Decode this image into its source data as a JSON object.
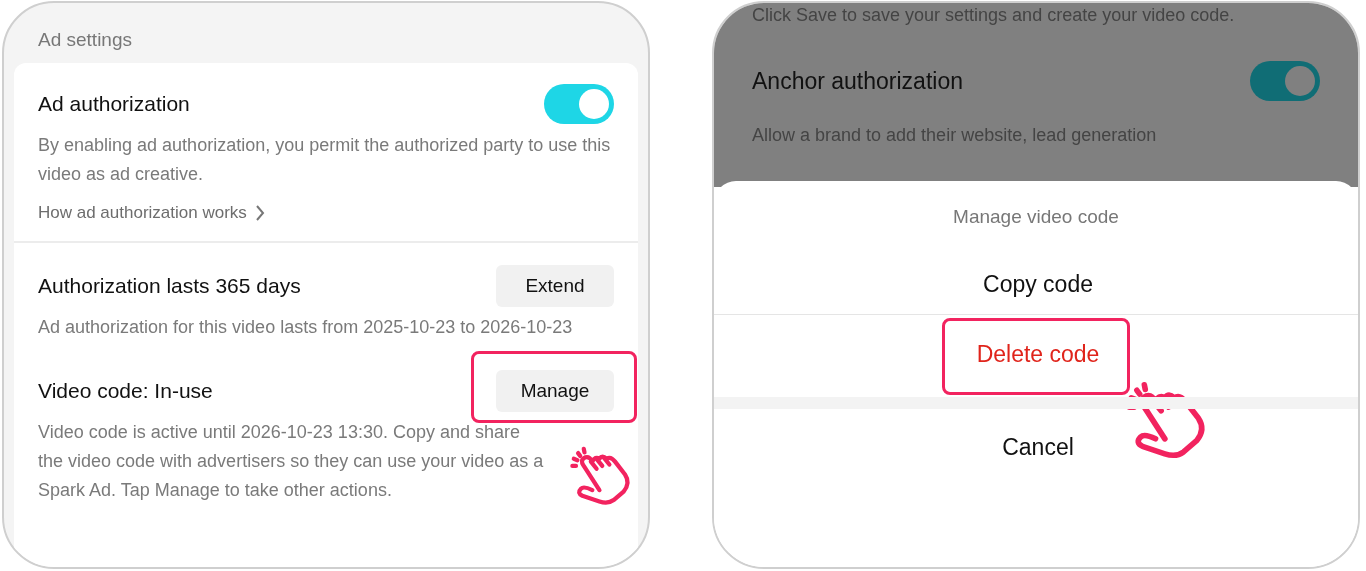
{
  "left_screen": {
    "section_title": "Ad settings",
    "settings": [
      {
        "kind": "toggle",
        "title": "Ad authorization",
        "on": true,
        "description": "By enabling ad authorization, you permit the authorized party to use this video as ad creative.",
        "link": "How ad authorization works"
      },
      {
        "kind": "button",
        "title": "Authorization lasts 365 days",
        "button": "Extend",
        "highlighted": false,
        "description": "Ad authorization for this video lasts from 2025-10-23 to 2026-10-23"
      },
      {
        "kind": "button",
        "title": "Video code: In-use",
        "button": "Manage",
        "highlighted": true,
        "description": "Video code is active until 2026-10-23 13:30. Copy and share the video code with advertisers so they can use your video as a Spark Ad. Tap Manage to take other actions."
      }
    ]
  },
  "right_screen": {
    "background": {
      "text": "Click Save to save your settings and create your video code.",
      "setting": {
        "title": "Anchor authorization",
        "on": true,
        "description": "Allow a brand to add their website, lead generation"
      }
    },
    "sheet": {
      "title": "Manage video code",
      "actions": [
        {
          "label": "Copy code",
          "kind": "normal",
          "highlighted": false
        },
        {
          "label": "Delete code",
          "kind": "destructive",
          "highlighted": true
        },
        {
          "label": "Cancel",
          "kind": "cancel",
          "highlighted": false
        }
      ]
    }
  }
}
